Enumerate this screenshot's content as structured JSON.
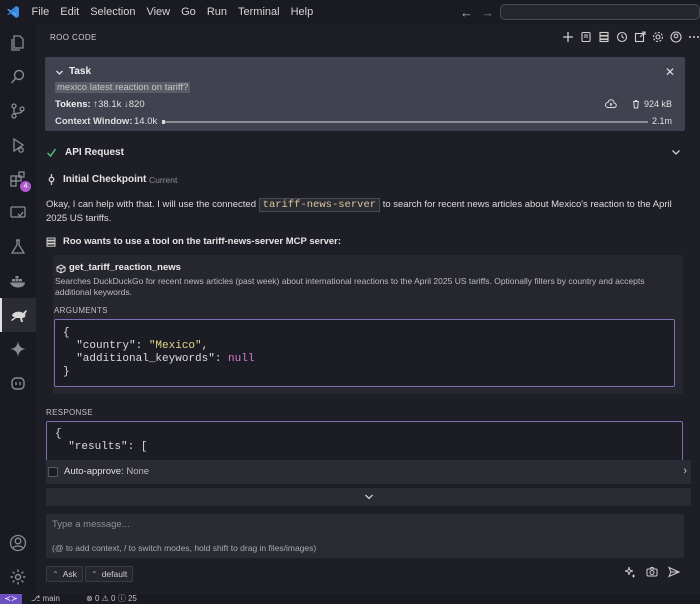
{
  "menu": [
    "File",
    "Edit",
    "Selection",
    "View",
    "Go",
    "Run",
    "Terminal",
    "Help"
  ],
  "activity": {
    "extensions_badge": "4"
  },
  "panel": {
    "title": "ROO CODE"
  },
  "task": {
    "label": "Task",
    "question": "mexico latest reaction on tariff?",
    "tokens_label": "Tokens:",
    "tokens_up": "38.1k",
    "tokens_down": "820",
    "size": "924 kB",
    "context_label": "Context Window:",
    "context_used": "14.0k",
    "context_max": "2.1m",
    "context_fraction": 0.0067
  },
  "api_request": {
    "label": "API Request"
  },
  "checkpoint": {
    "label": "Initial Checkpoint",
    "status": "Current"
  },
  "message": {
    "before": "Okay, I can help with that. I will use the connected ",
    "server_chip": "tariff-news-server",
    "after": " to search for recent news articles about Mexico's reaction to the April 2025 US tariffs."
  },
  "mcp": {
    "heading": "Roo wants to use a tool on the tariff-news-server MCP server:",
    "tool_name": "get_tariff_reaction_news",
    "tool_desc": "Searches DuckDuckGo for recent news articles (past week) about international reactions to the April 2025 US tariffs. Optionally filters by country and accepts additional keywords.",
    "args_label": "ARGUMENTS",
    "args": {
      "open": "{",
      "country_key": "\"country\"",
      "country_val": "\"Mexico\"",
      "kw_key": "\"additional_keywords\"",
      "kw_val": "null",
      "close": "}"
    }
  },
  "response": {
    "label": "RESPONSE",
    "line1": "{",
    "line2": "  \"results\": ["
  },
  "auto_approve": {
    "label": "Auto-approve:",
    "value": "None"
  },
  "chat": {
    "placeholder": "Type a message...",
    "hint": "(@ to add context, / to switch modes, hold shift to drag in files/images)"
  },
  "modes": {
    "mode": "Ask",
    "profile": "default"
  },
  "status": {
    "branch": "main",
    "errors": "0",
    "warnings": "0",
    "info": "25"
  }
}
